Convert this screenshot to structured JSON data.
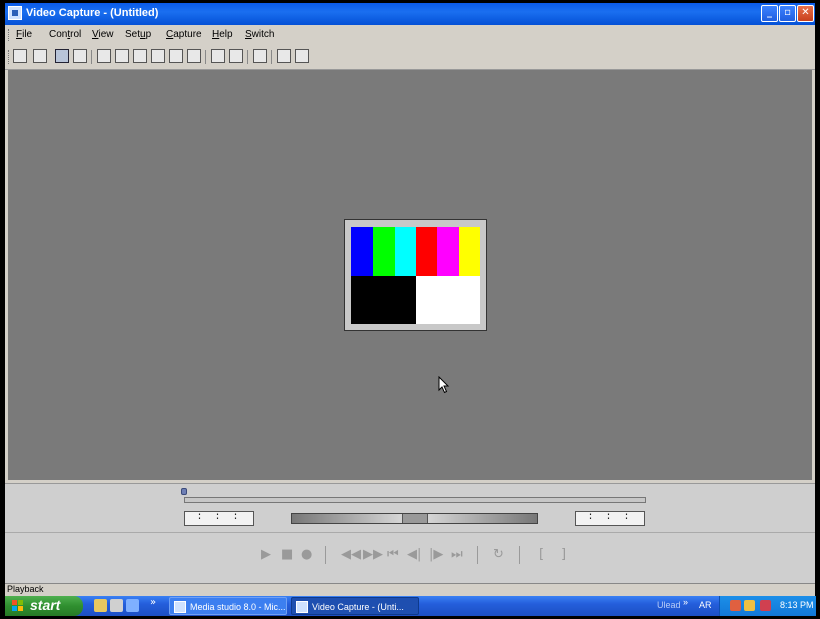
{
  "window": {
    "title": "Video Capture - (Untitled)"
  },
  "menu": {
    "file": {
      "ul": "F",
      "rest": "ile"
    },
    "control": {
      "pre": "Con",
      "ul": "t",
      "rest": "rol"
    },
    "view": {
      "ul": "V",
      "rest": "iew"
    },
    "setup": {
      "pre": "Set",
      "ul": "u",
      "rest": "p"
    },
    "capture": {
      "ul": "C",
      "rest": "apture"
    },
    "help": {
      "ul": "H",
      "rest": "elp"
    },
    "switch": {
      "ul": "S",
      "rest": "witch"
    }
  },
  "color_bars": {
    "top": [
      "#0000ff",
      "#00ff00",
      "#00ffff",
      "#ff0000",
      "#ff00ff",
      "#ffff00"
    ],
    "bottom": [
      "#000000",
      "#ffffff"
    ]
  },
  "controls": {
    "timecode_start": ": : :",
    "timecode_end": ": : :",
    "transport_icons": [
      "play-icon",
      "stop-icon",
      "record-icon",
      "rewind-icon",
      "fast-forward-icon",
      "go-to-start-icon",
      "previous-frame-icon",
      "next-frame-icon",
      "go-to-end-icon",
      "repeat-icon",
      "mark-in-icon",
      "mark-out-icon"
    ]
  },
  "status": {
    "text": "Playback"
  },
  "taskbar": {
    "start_label": "start",
    "chevron": "»",
    "tasks": [
      {
        "label": "Media studio 8.0 - Mic..."
      },
      {
        "label": "Video Capture - (Unti..."
      }
    ],
    "tray": {
      "toolbar_label": "Ulead",
      "chevron": "»",
      "language": "AR",
      "clock": "8:13 PM"
    }
  },
  "colors": {
    "titlebar": "#0a5ae8",
    "preview_background": "#7a7a7a",
    "start_button": "#2f8f2f",
    "taskbar": "#245edb"
  }
}
